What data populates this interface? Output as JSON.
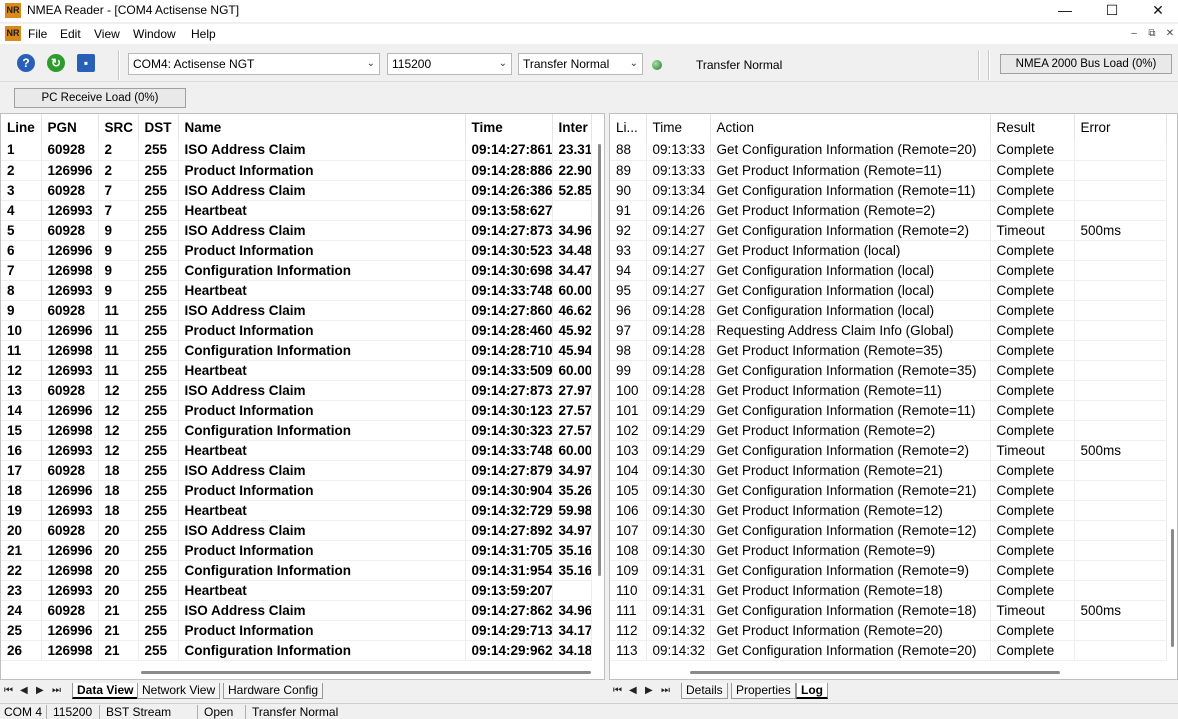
{
  "window": {
    "app_icon_text": "NR",
    "title": "NMEA Reader - [COM4 Actisense NGT]",
    "minimize": "—",
    "maximize": "☐",
    "close": "✕"
  },
  "menu": {
    "items": [
      "File",
      "Edit",
      "View",
      "Window",
      "Help"
    ],
    "mdi": [
      "–",
      "⧉",
      "✕"
    ]
  },
  "toolbar": {
    "port_select": "COM4: Actisense NGT",
    "baud_select": "115200",
    "transfer_select": "Transfer Normal",
    "transfer_status": "Transfer Normal",
    "bus_load": "NMEA 2000 Bus Load (0%)",
    "pc_receive_load": "PC Receive Load (0%)",
    "icons": [
      "help-icon",
      "connect-icon",
      "save-icon"
    ]
  },
  "left_table": {
    "columns": [
      "Line",
      "PGN",
      "SRC",
      "DST",
      "Name",
      "Time",
      "Inter"
    ],
    "rows": [
      [
        "1",
        "60928",
        "2",
        "255",
        "ISO Address Claim",
        "09:14:27:861",
        "23.31"
      ],
      [
        "2",
        "126996",
        "2",
        "255",
        "Product Information",
        "09:14:28:886",
        "22.90"
      ],
      [
        "3",
        "60928",
        "7",
        "255",
        "ISO Address Claim",
        "09:14:26:386",
        "52.85"
      ],
      [
        "4",
        "126993",
        "7",
        "255",
        "Heartbeat",
        "09:13:58:627",
        ""
      ],
      [
        "5",
        "60928",
        "9",
        "255",
        "ISO Address Claim",
        "09:14:27:873",
        "34.96"
      ],
      [
        "6",
        "126996",
        "9",
        "255",
        "Product Information",
        "09:14:30:523",
        "34.48"
      ],
      [
        "7",
        "126998",
        "9",
        "255",
        "Configuration Information",
        "09:14:30:698",
        "34.47"
      ],
      [
        "8",
        "126993",
        "9",
        "255",
        "Heartbeat",
        "09:14:33:748",
        "60.00"
      ],
      [
        "9",
        "60928",
        "11",
        "255",
        "ISO Address Claim",
        "09:14:27:860",
        "46.62"
      ],
      [
        "10",
        "126996",
        "11",
        "255",
        "Product Information",
        "09:14:28:460",
        "45.92"
      ],
      [
        "11",
        "126998",
        "11",
        "255",
        "Configuration Information",
        "09:14:28:710",
        "45.94"
      ],
      [
        "12",
        "126993",
        "11",
        "255",
        "Heartbeat",
        "09:14:33:509",
        "60.00"
      ],
      [
        "13",
        "60928",
        "12",
        "255",
        "ISO Address Claim",
        "09:14:27:873",
        "27.97"
      ],
      [
        "14",
        "126996",
        "12",
        "255",
        "Product Information",
        "09:14:30:123",
        "27.57"
      ],
      [
        "15",
        "126998",
        "12",
        "255",
        "Configuration Information",
        "09:14:30:323",
        "27.57"
      ],
      [
        "16",
        "126993",
        "12",
        "255",
        "Heartbeat",
        "09:14:33:748",
        "60.00"
      ],
      [
        "17",
        "60928",
        "18",
        "255",
        "ISO Address Claim",
        "09:14:27:879",
        "34.97"
      ],
      [
        "18",
        "126996",
        "18",
        "255",
        "Product Information",
        "09:14:30:904",
        "35.26"
      ],
      [
        "19",
        "126993",
        "18",
        "255",
        "Heartbeat",
        "09:14:32:729",
        "59.98"
      ],
      [
        "20",
        "60928",
        "20",
        "255",
        "ISO Address Claim",
        "09:14:27:892",
        "34.97"
      ],
      [
        "21",
        "126996",
        "20",
        "255",
        "Product Information",
        "09:14:31:705",
        "35.16"
      ],
      [
        "22",
        "126998",
        "20",
        "255",
        "Configuration Information",
        "09:14:31:954",
        "35.16"
      ],
      [
        "23",
        "126993",
        "20",
        "255",
        "Heartbeat",
        "09:13:59:207",
        ""
      ],
      [
        "24",
        "60928",
        "21",
        "255",
        "ISO Address Claim",
        "09:14:27:862",
        "34.96"
      ],
      [
        "25",
        "126996",
        "21",
        "255",
        "Product Information",
        "09:14:29:713",
        "34.17"
      ],
      [
        "26",
        "126998",
        "21",
        "255",
        "Configuration Information",
        "09:14:29:962",
        "34.18"
      ]
    ]
  },
  "right_table": {
    "columns": [
      "Li...",
      "Time",
      "Action",
      "Result",
      "Error"
    ],
    "rows": [
      [
        "88",
        "09:13:33",
        "Get Configuration Information (Remote=20)",
        "Complete",
        ""
      ],
      [
        "89",
        "09:13:33",
        "Get Product Information (Remote=11)",
        "Complete",
        ""
      ],
      [
        "90",
        "09:13:34",
        "Get Configuration Information (Remote=11)",
        "Complete",
        ""
      ],
      [
        "91",
        "09:14:26",
        "Get Product Information (Remote=2)",
        "Complete",
        ""
      ],
      [
        "92",
        "09:14:27",
        "Get Configuration Information (Remote=2)",
        "Timeout",
        "500ms"
      ],
      [
        "93",
        "09:14:27",
        "Get Product Information (local)",
        "Complete",
        ""
      ],
      [
        "94",
        "09:14:27",
        "Get Configuration Information (local)",
        "Complete",
        ""
      ],
      [
        "95",
        "09:14:27",
        "Get Configuration Information (local)",
        "Complete",
        ""
      ],
      [
        "96",
        "09:14:28",
        "Get Configuration Information (local)",
        "Complete",
        ""
      ],
      [
        "97",
        "09:14:28",
        "Requesting Address Claim Info (Global)",
        "Complete",
        ""
      ],
      [
        "98",
        "09:14:28",
        "Get Product Information (Remote=35)",
        "Complete",
        ""
      ],
      [
        "99",
        "09:14:28",
        "Get Configuration Information (Remote=35)",
        "Complete",
        ""
      ],
      [
        "100",
        "09:14:28",
        "Get Product Information (Remote=11)",
        "Complete",
        ""
      ],
      [
        "101",
        "09:14:29",
        "Get Configuration Information (Remote=11)",
        "Complete",
        ""
      ],
      [
        "102",
        "09:14:29",
        "Get Product Information (Remote=2)",
        "Complete",
        ""
      ],
      [
        "103",
        "09:14:29",
        "Get Configuration Information (Remote=2)",
        "Timeout",
        "500ms"
      ],
      [
        "104",
        "09:14:30",
        "Get Product Information (Remote=21)",
        "Complete",
        ""
      ],
      [
        "105",
        "09:14:30",
        "Get Configuration Information (Remote=21)",
        "Complete",
        ""
      ],
      [
        "106",
        "09:14:30",
        "Get Product Information (Remote=12)",
        "Complete",
        ""
      ],
      [
        "107",
        "09:14:30",
        "Get Configuration Information (Remote=12)",
        "Complete",
        ""
      ],
      [
        "108",
        "09:14:30",
        "Get Product Information (Remote=9)",
        "Complete",
        ""
      ],
      [
        "109",
        "09:14:31",
        "Get Configuration Information (Remote=9)",
        "Complete",
        ""
      ],
      [
        "110",
        "09:14:31",
        "Get Product Information (Remote=18)",
        "Complete",
        ""
      ],
      [
        "111",
        "09:14:31",
        "Get Configuration Information (Remote=18)",
        "Timeout",
        "500ms"
      ],
      [
        "112",
        "09:14:32",
        "Get Product Information (Remote=20)",
        "Complete",
        ""
      ],
      [
        "113",
        "09:14:32",
        "Get Configuration Information (Remote=20)",
        "Complete",
        ""
      ]
    ]
  },
  "left_tabs": {
    "nav": [
      "⏮",
      "◀",
      "▶",
      "⏭"
    ],
    "tabs": [
      "Data View",
      "Network View",
      "Hardware Config"
    ],
    "active": "Data View"
  },
  "right_tabs": {
    "nav": [
      "⏮",
      "◀",
      "▶",
      "⏭"
    ],
    "tabs": [
      "Details",
      "Properties",
      "Log"
    ],
    "active": "Log"
  },
  "statusbar": {
    "port": "COM 4",
    "baud": "115200",
    "stream": "BST Stream",
    "state": "Open",
    "mode": "Transfer Normal"
  },
  "colors": {
    "app_icon": "#d98a1a",
    "led_green": "#1f7a1f",
    "help_icon": "#2a5fb8",
    "connect_icon": "#2e9b2e",
    "save_icon": "#2a5fb8"
  }
}
